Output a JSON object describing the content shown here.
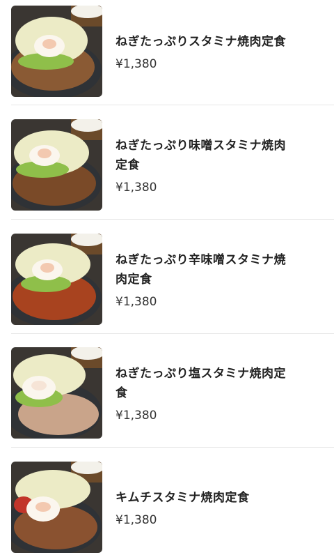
{
  "menu": {
    "items": [
      {
        "name_line1": "ねぎたっぷりスタミナ焼肉定食",
        "name_line2": "",
        "price": "¥1,380",
        "meat_color": "#8a5a34"
      },
      {
        "name_line1": "ねぎたっぷり味噌スタミナ焼肉",
        "name_line2": "定食",
        "price": "¥1,380",
        "meat_color": "#7a4a28"
      },
      {
        "name_line1": "ねぎたっぷり辛味噌スタミナ焼",
        "name_line2": "肉定食",
        "price": "¥1,380",
        "meat_color": "#a8431f"
      },
      {
        "name_line1": "ねぎたっぷり塩スタミナ焼肉定",
        "name_line2": "食",
        "price": "¥1,380",
        "meat_color": "#c9a48a"
      },
      {
        "name_line1": "キムチスタミナ焼肉定食",
        "name_line2": "",
        "price": "¥1,380",
        "meat_color": "#8a5230"
      }
    ]
  },
  "colors": {
    "divider": "#e6e6e6",
    "text": "#222222",
    "price_text": "#333333"
  }
}
